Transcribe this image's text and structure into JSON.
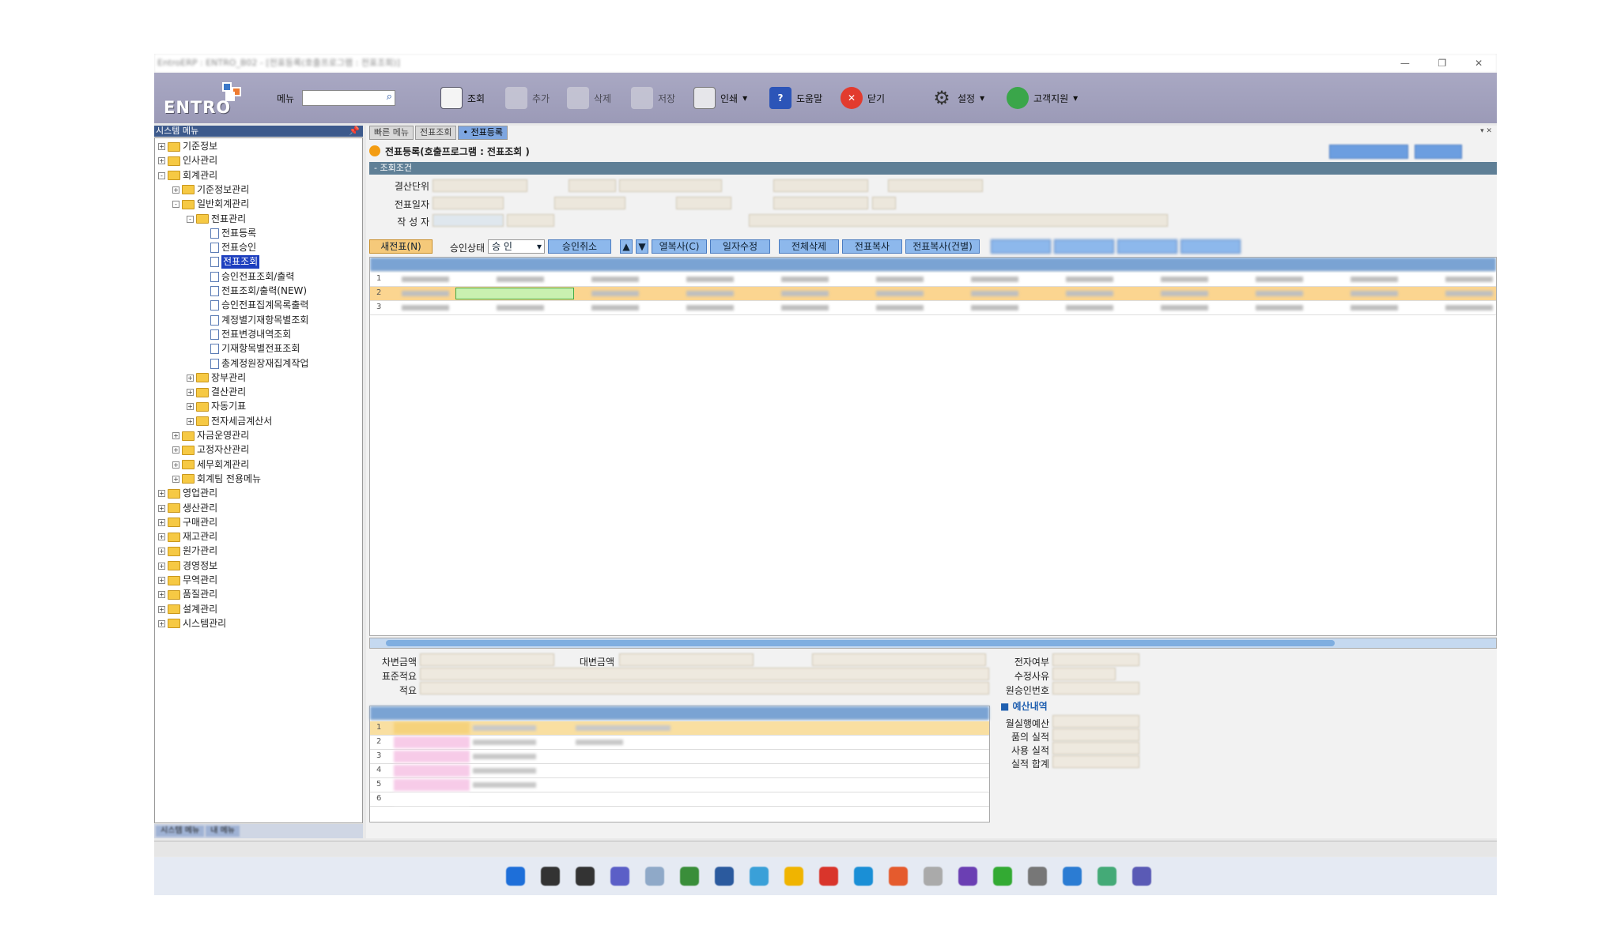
{
  "window": {
    "title": "EntroERP : ENTRO_B02 - [전표등록(호출프로그램 : 전표조회)]"
  },
  "toolbar": {
    "logo": "ENTRO",
    "menu_label": "메뉴",
    "query": "조회",
    "add": "추가",
    "delete": "삭제",
    "save": "저장",
    "print": "인쇄",
    "help": "도움말",
    "close": "닫기",
    "settings": "설정",
    "support": "고객지원"
  },
  "tree": {
    "header": "시스템 메뉴",
    "items": [
      {
        "label": "기준정보",
        "level": 0,
        "kind": "folder",
        "sign": "+"
      },
      {
        "label": "인사관리",
        "level": 0,
        "kind": "folder",
        "sign": "+"
      },
      {
        "label": "회계관리",
        "level": 0,
        "kind": "folder",
        "sign": "-"
      },
      {
        "label": "기준정보관리",
        "level": 1,
        "kind": "folder",
        "sign": "+"
      },
      {
        "label": "일반회계관리",
        "level": 1,
        "kind": "folder",
        "sign": "-"
      },
      {
        "label": "전표관리",
        "level": 2,
        "kind": "folder",
        "sign": "-"
      },
      {
        "label": "전표등록",
        "level": 3,
        "kind": "doc"
      },
      {
        "label": "전표승인",
        "level": 3,
        "kind": "doc"
      },
      {
        "label": "전표조회",
        "level": 3,
        "kind": "doc",
        "selected": true
      },
      {
        "label": "승인전표조회/출력",
        "level": 3,
        "kind": "doc"
      },
      {
        "label": "전표조회/출력(NEW)",
        "level": 3,
        "kind": "doc"
      },
      {
        "label": "승인전표집계목록출력",
        "level": 3,
        "kind": "doc"
      },
      {
        "label": "계정별기재항목별조회",
        "level": 3,
        "kind": "doc"
      },
      {
        "label": "전표변경내역조회",
        "level": 3,
        "kind": "doc"
      },
      {
        "label": "기재항목별전표조회",
        "level": 3,
        "kind": "doc"
      },
      {
        "label": "총계정원장재집계작업",
        "level": 3,
        "kind": "doc"
      },
      {
        "label": "장부관리",
        "level": 2,
        "kind": "folder",
        "sign": "+"
      },
      {
        "label": "결산관리",
        "level": 2,
        "kind": "folder",
        "sign": "+"
      },
      {
        "label": "자동기표",
        "level": 2,
        "kind": "folder",
        "sign": "+"
      },
      {
        "label": "전자세금계산서",
        "level": 2,
        "kind": "folder",
        "sign": "+"
      },
      {
        "label": "자금운영관리",
        "level": 1,
        "kind": "folder",
        "sign": "+"
      },
      {
        "label": "고정자산관리",
        "level": 1,
        "kind": "folder",
        "sign": "+"
      },
      {
        "label": "세무회계관리",
        "level": 1,
        "kind": "folder",
        "sign": "+"
      },
      {
        "label": "회계팀 전용메뉴",
        "level": 1,
        "kind": "folder",
        "sign": "+"
      },
      {
        "label": "영업관리",
        "level": 0,
        "kind": "folder",
        "sign": "+"
      },
      {
        "label": "생산관리",
        "level": 0,
        "kind": "folder",
        "sign": "+"
      },
      {
        "label": "구매관리",
        "level": 0,
        "kind": "folder",
        "sign": "+"
      },
      {
        "label": "재고관리",
        "level": 0,
        "kind": "folder",
        "sign": "+"
      },
      {
        "label": "원가관리",
        "level": 0,
        "kind": "folder",
        "sign": "+"
      },
      {
        "label": "경영정보",
        "level": 0,
        "kind": "folder",
        "sign": "+"
      },
      {
        "label": "무역관리",
        "level": 0,
        "kind": "folder",
        "sign": "+"
      },
      {
        "label": "품질관리",
        "level": 0,
        "kind": "folder",
        "sign": "+"
      },
      {
        "label": "설계관리",
        "level": 0,
        "kind": "folder",
        "sign": "+"
      },
      {
        "label": "시스템관리",
        "level": 0,
        "kind": "folder",
        "sign": "+"
      }
    ],
    "bottom_tabs": [
      "시스템 메뉴",
      "내 메뉴"
    ]
  },
  "tabs": [
    {
      "label": "빠른 메뉴",
      "active": false
    },
    {
      "label": "전표조회",
      "active": false
    },
    {
      "label": "• 전표등록",
      "active": true
    }
  ],
  "page": {
    "title": "전표등록(호출프로그램 : 전표조회 )",
    "condition_header": "- 조회조건",
    "labels": {
      "settle_unit": "결산단위",
      "voucher_date": "전표일자",
      "writer": "작 성 자",
      "approval_state": "승인상태",
      "approval_value": "승   인"
    }
  },
  "buttons": {
    "new_voucher": "새전표(N)",
    "cancel_approval": "승인취소",
    "col_copy": "열복사(C)",
    "date_edit": "일자수정",
    "delete_all": "전체삭제",
    "copy_voucher": "전표복사",
    "copy_voucher_each": "전표복사(건별)"
  },
  "grid": {
    "rows": [
      {
        "no": "1",
        "highlight": false
      },
      {
        "no": "2",
        "highlight": true
      },
      {
        "no": "3",
        "highlight": false
      }
    ]
  },
  "bottom": {
    "debit_label": "차변금액",
    "credit_label": "대변금액",
    "std_summary_label": "표준적요",
    "summary_label": "적요",
    "electronic_label": "전자여부",
    "edit_reason_label": "수정사유",
    "orig_approval_label": "원승인번호",
    "budget_title": "■ 예산내역",
    "budget_items": [
      "월실행예산",
      "품의 실적",
      "사용 실적",
      "실적 합계"
    ],
    "sub_rows": [
      "1",
      "2",
      "3",
      "4",
      "5",
      "6"
    ]
  },
  "colors": {
    "toolbar_bg": "#a9a8c3",
    "grid_header": "#7aa3d3",
    "highlight_row": "#fbd590",
    "tree_selected": "#1d3fbf"
  }
}
